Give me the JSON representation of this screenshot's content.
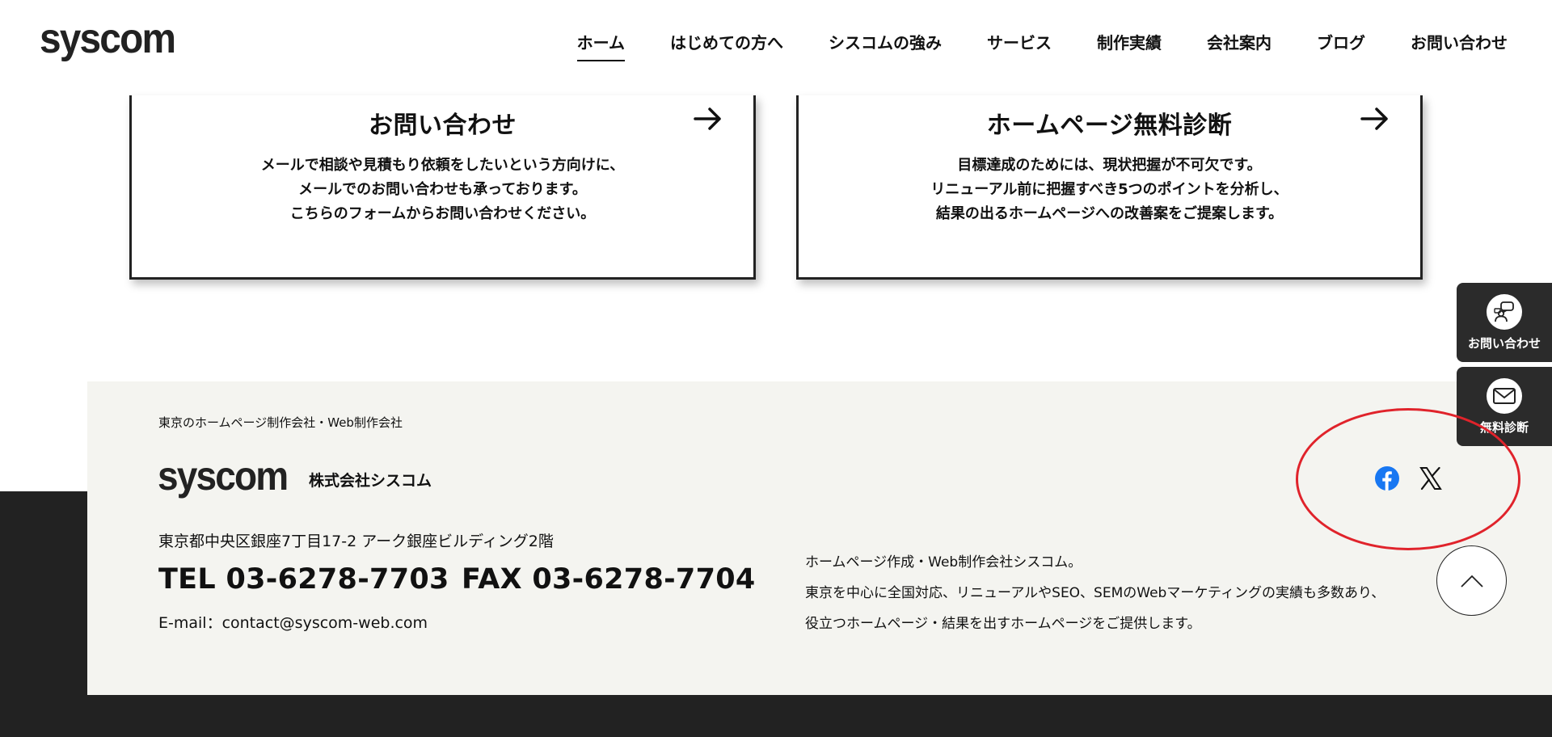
{
  "header": {
    "logo": "syscom",
    "nav": [
      {
        "label": "ホーム"
      },
      {
        "label": "はじめての方へ"
      },
      {
        "label": "シスコムの強み"
      },
      {
        "label": "サービス"
      },
      {
        "label": "制作実績"
      },
      {
        "label": "会社案内"
      },
      {
        "label": "ブログ"
      },
      {
        "label": "お問い合わせ"
      }
    ],
    "active_index": 0
  },
  "cards": [
    {
      "title": "お問い合わせ",
      "lines": [
        "メールで相談や見積もり依頼をしたいという方向けに、",
        "メールでのお問い合わせも承っております。",
        "こちらのフォームからお問い合わせください。"
      ]
    },
    {
      "title": "ホームページ無料診断",
      "lines": [
        "目標達成のためには、現状把握が不可欠です。",
        "リニューアル前に把握すべき5つのポイントを分析し、",
        "結果の出るホームページへの改善案をご提案します。"
      ]
    }
  ],
  "footer": {
    "tagline": "東京のホームページ制作会社・Web制作会社",
    "logo": "syscom",
    "company": "株式会社シスコム",
    "address": "東京都中央区銀座7丁目17-2 アーク銀座ビルディング2階",
    "tel": "TEL 03-6278-7703",
    "fax": "FAX 03-6278-7704",
    "email": "E-mail：contact@syscom-web.com",
    "about": [
      "ホームページ作成・Web制作会社シスコム。",
      "東京を中心に全国対応、リニューアルやSEO、SEMのWebマーケティングの実績も多数あり、",
      "役立つホームページ・結果を出すホームページをご提供します。"
    ],
    "social": {
      "facebook_icon": "facebook-icon",
      "x_icon": "x-icon"
    }
  },
  "side_buttons": {
    "contact": {
      "label": "お問い合わせ",
      "icon": "chat-person-icon"
    },
    "diagnosis": {
      "label": "無料診断",
      "icon": "mail-icon"
    }
  },
  "colors": {
    "accent_dark": "#222222",
    "footer_bg": "#f4f4f0",
    "facebook_blue": "#1877f2",
    "annotation_red": "#e0232b"
  }
}
